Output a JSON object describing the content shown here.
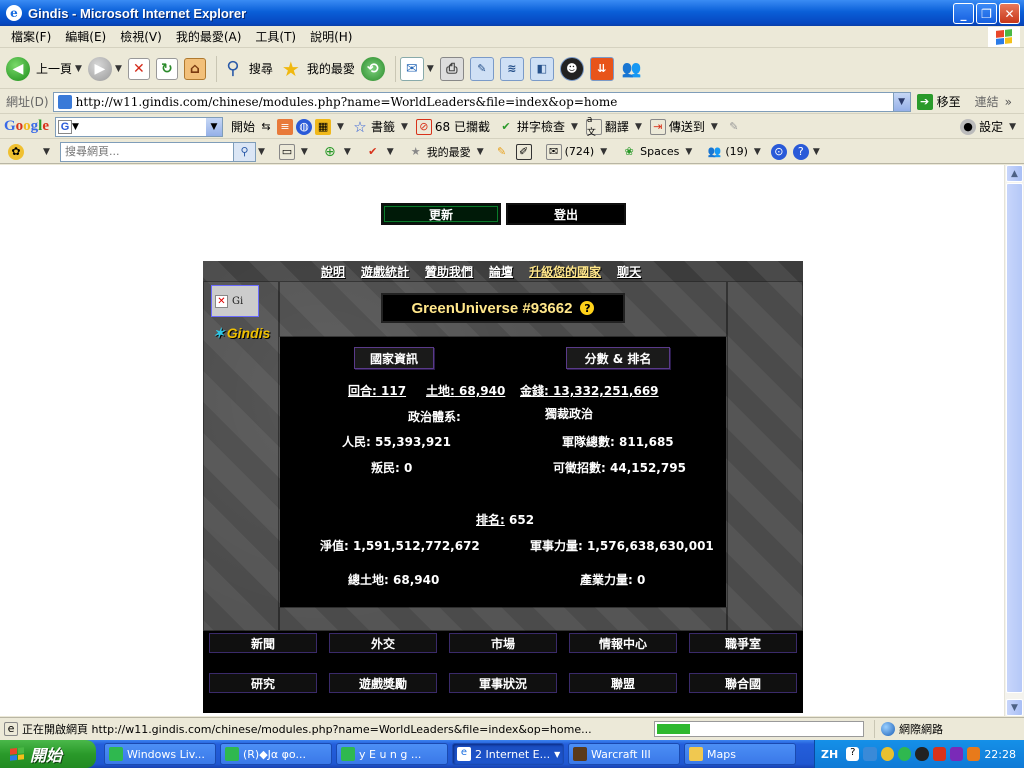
{
  "window": {
    "title": "Gindis - Microsoft Internet Explorer"
  },
  "menubar": {
    "items": [
      "檔案(F)",
      "編輯(E)",
      "檢視(V)",
      "我的最愛(A)",
      "工具(T)",
      "說明(H)"
    ]
  },
  "toolbar": {
    "back_label": "上一頁",
    "search_label": "搜尋",
    "favorites_label": "我的最愛"
  },
  "address": {
    "label": "網址(D)",
    "url": "http://w11.gindis.com/chinese/modules.php?name=WorldLeaders&file=index&op=home",
    "go_label": "移至",
    "links_label": "連結"
  },
  "google": {
    "logo": "Google",
    "start_label": "開始",
    "blocked_label": "68 已攔截",
    "spellcheck_label": "拼字檢查",
    "translate_label": "翻譯",
    "sendto_label": "傳送到",
    "settings_label": "設定"
  },
  "livebar": {
    "search_placeholder": "搜尋網頁...",
    "favorites_label": "我的最愛",
    "mail_count": "(724)",
    "spaces_label": "Spaces",
    "contacts_count": "(19)"
  },
  "page": {
    "update_button": "更新",
    "logout_button": "登出",
    "nav": [
      "說明",
      "遊戲統計",
      "贊助我們",
      "論壇",
      "升級您的國家",
      "聊天"
    ],
    "broken_image_alt": "Gi",
    "logo_text": "Gindis",
    "country_name": "GreenUniverse #93662",
    "tab_info": "國家資訊",
    "tab_score": "分數 & 排名",
    "stats": {
      "turns_label": "回合:",
      "turns": "117",
      "land_label": "土地:",
      "land": "68,940",
      "money_label": "金錢:",
      "money": "13,332,251,669",
      "government_label": "政治體系:",
      "government": "獨裁政治",
      "population_label": "人民:",
      "population": "55,393,921",
      "army_label": "軍隊總數:",
      "army": "811,685",
      "rebels_label": "叛民:",
      "rebels": "0",
      "recruitable_label": "可徵招數:",
      "recruitable": "44,152,795",
      "rank_label": "排名:",
      "rank": "652",
      "networth_label": "淨值:",
      "networth": "1,591,512,772,672",
      "military_label": "軍事力量:",
      "military": "1,576,638,630,001",
      "totalland_label": "總土地:",
      "totalland": "68,940",
      "industry_label": "產業力量:",
      "industry": "0"
    },
    "bottom_menu": [
      "新聞",
      "外交",
      "市場",
      "情報中心",
      "職爭室",
      "研究",
      "遊戲獎勵",
      "軍事狀況",
      "聯盟",
      "聯合國"
    ]
  },
  "status": {
    "text": "正在開啟網頁 http://w11.gindis.com/chinese/modules.php?name=WorldLeaders&file=index&op=home...",
    "progress": 0.18,
    "zone": "網際網路"
  },
  "taskbar": {
    "start_label": "開始",
    "tasks": [
      "Windows Liv...",
      "(R)◆Jα φo...",
      "y E u n g ...",
      "2 Internet E...",
      "Warcraft III",
      "Maps"
    ],
    "lang": "ZH",
    "clock": "22:28"
  }
}
